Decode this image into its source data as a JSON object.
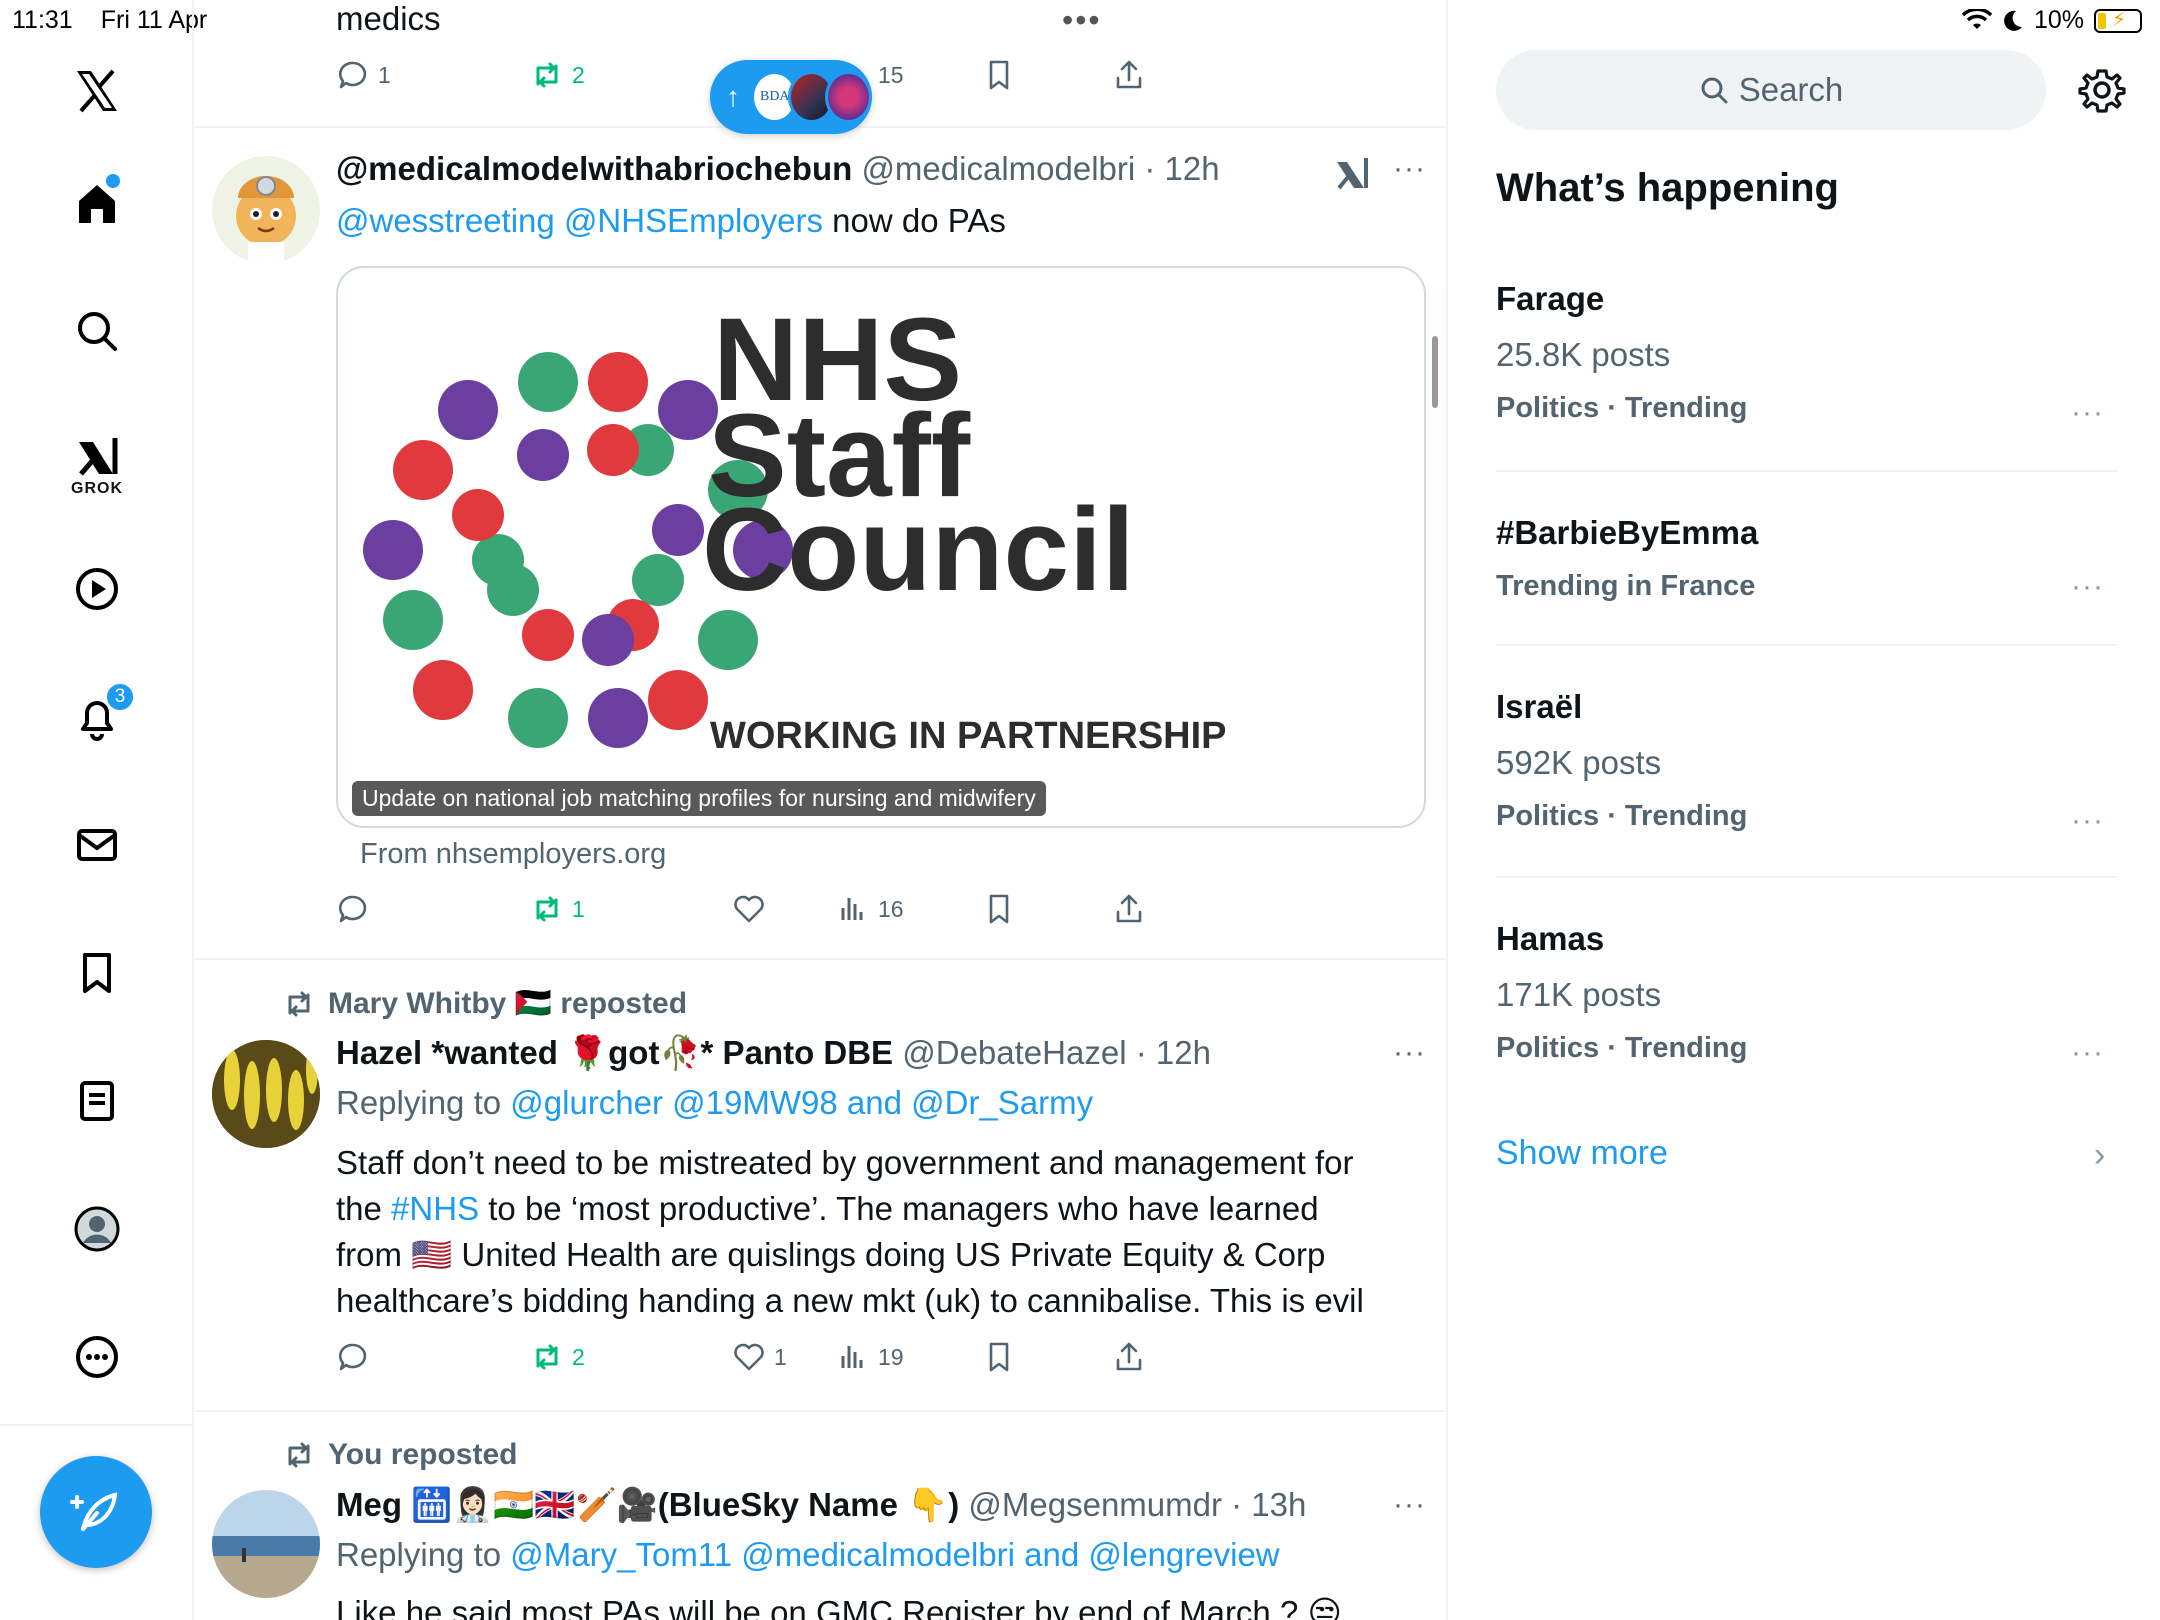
{
  "status": {
    "time": "11:31",
    "date": "Fri 11 Apr",
    "battery": "10%"
  },
  "nav": {
    "grok_label": "GROK",
    "notifications_badge": "3"
  },
  "new_posts": {
    "arrow": "↑",
    "avatar1": "BDA"
  },
  "prev_tweet": {
    "text": "medics",
    "replies": "1",
    "reposts": "2",
    "views": "15"
  },
  "tweet1": {
    "name": "@medicalmodelwithabriochebun",
    "handle": "@medicalmodelbri",
    "time": "12h",
    "mention1": "@wesstreeting",
    "mention2": "@NHSEmployers",
    "text_rest": "now do PAs",
    "card": {
      "logo_line1": "NHS",
      "logo_line2": "Staff",
      "logo_line3": "Council",
      "logo_tag": "WORKING IN PARTNERSHIP",
      "caption": "Update on national job matching profiles for nursing and midwifery",
      "from": "From nhsemployers.org"
    },
    "reposts": "1",
    "views": "16"
  },
  "tweet2": {
    "social": "Mary Whitby 🇵🇸 reposted",
    "name": "Hazel *wanted 🌹got🥀* Panto DBE",
    "handle": "@DebateHazel",
    "time": "12h",
    "replying_prefix": "Replying to",
    "replying_to": "@glurcher @19MW98 and @Dr_Sarmy",
    "line1": "Staff don’t need to be mistreated by government and management for",
    "line2_a": "the",
    "line2_hashtag": "#NHS",
    "line2_b": "to be ‘most productive’. The managers who have learned",
    "line3": "from 🇺🇸 United Health are quislings doing US Private Equity & Corp",
    "line4": "healthcare’s bidding handing a new mkt (uk) to cannibalise.  This is evil",
    "reposts": "2",
    "likes": "1",
    "views": "19"
  },
  "tweet3": {
    "social": "You reposted",
    "name": "Meg 🛗👩🏻‍⚕️🇮🇳🇬🇧🏏🎥(BlueSky Name 👇)",
    "handle": "@Megsenmumdr",
    "time": "13h",
    "replying_prefix": "Replying to",
    "replying_to": "@Mary_Tom11 @medicalmodelbri and @lengreview",
    "line1": "Like he said most PAs will be on GMC Register by end of March ? 😒"
  },
  "right": {
    "search_placeholder": "Search",
    "title": "What’s happening",
    "trends": [
      {
        "name": "Farage",
        "count": "25.8K posts",
        "context": "Politics · Trending"
      },
      {
        "name": "#BarbieByEmma",
        "count": "",
        "context": "Trending in France"
      },
      {
        "name": "Israël",
        "count": "592K posts",
        "context": "Politics · Trending"
      },
      {
        "name": "Hamas",
        "count": "171K posts",
        "context": "Politics · Trending"
      }
    ],
    "show_more": "Show more"
  },
  "colors": {
    "accent": "#1d9bf0",
    "repost_green": "#00ba7c",
    "text": "#0f1419",
    "muted": "#536471"
  }
}
